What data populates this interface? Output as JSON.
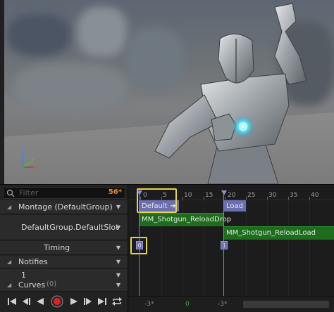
{
  "colors": {
    "accent_count": "#e58a2a",
    "section": "#6b6fb0",
    "notify_track": "#1d6d1d",
    "highlight": "#e8d44c"
  },
  "viewport": {
    "axis_labels": {
      "z": "Z",
      "y": "Y",
      "x": "X"
    }
  },
  "filter": {
    "placeholder": "Filter",
    "count": "56*"
  },
  "tracks": {
    "montage": "Montage (DefaultGroup)",
    "slot": "DefaultGroup.DefaultSlot",
    "timing": "Timing",
    "notifies": "Notifies",
    "notify_track": "1",
    "curves": "Curves",
    "curves_count": "(0)"
  },
  "transport": {
    "buttons": [
      "go-to-start",
      "step-back",
      "play-reverse",
      "record",
      "play-forward",
      "step-forward",
      "go-to-end",
      "loop"
    ]
  },
  "timeline": {
    "ticks": [
      "0",
      "5",
      "10",
      "15",
      "20",
      "25",
      "30",
      "35",
      "40"
    ],
    "sections": [
      "Default",
      "Load"
    ],
    "notifies": [
      "MM_Shotgun_ReloadDrop",
      "MM_Shotgun_ReloadLoad"
    ],
    "timing_markers": [
      "0",
      "1"
    ],
    "bottom_labels": [
      "-3*",
      "0",
      "-3*"
    ]
  }
}
